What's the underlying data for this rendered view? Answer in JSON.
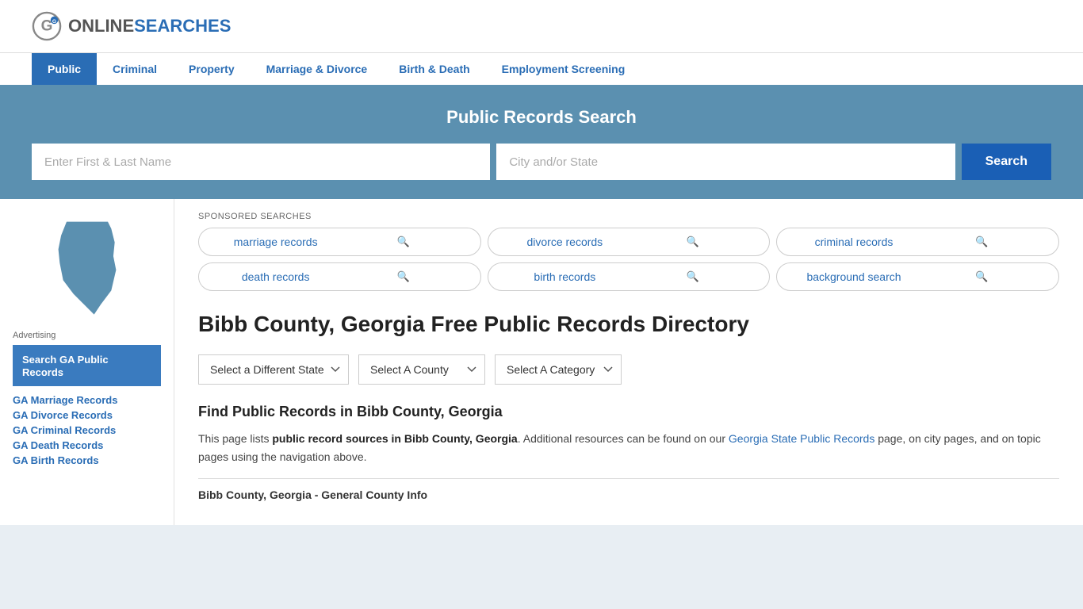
{
  "site": {
    "logo_text_online": "ONLINE",
    "logo_text_searches": "SEARCHES"
  },
  "nav": {
    "items": [
      {
        "label": "Public",
        "active": true
      },
      {
        "label": "Criminal",
        "active": false
      },
      {
        "label": "Property",
        "active": false
      },
      {
        "label": "Marriage & Divorce",
        "active": false
      },
      {
        "label": "Birth & Death",
        "active": false
      },
      {
        "label": "Employment Screening",
        "active": false
      }
    ]
  },
  "search_banner": {
    "title": "Public Records Search",
    "name_placeholder": "Enter First & Last Name",
    "location_placeholder": "City and/or State",
    "button_label": "Search"
  },
  "sponsored": {
    "label": "SPONSORED SEARCHES",
    "items": [
      "marriage records",
      "divorce records",
      "criminal records",
      "death records",
      "birth records",
      "background search"
    ]
  },
  "page": {
    "title": "Bibb County, Georgia Free Public Records Directory",
    "dropdowns": {
      "state": "Select a Different State",
      "county": "Select A County",
      "category": "Select A Category"
    },
    "find_heading": "Find Public Records in Bibb County, Georgia",
    "body_text_1": "This page lists ",
    "body_text_bold": "public record sources in Bibb County, Georgia",
    "body_text_2": ". Additional resources can be found on our ",
    "body_link_text": "Georgia State Public Records",
    "body_text_3": " page, on city pages, and on topic pages using the navigation above.",
    "county_info_heading": "Bibb County, Georgia - General County Info"
  },
  "sidebar": {
    "ad_label": "Advertising",
    "ad_block_text": "Search GA Public Records",
    "links": [
      "GA Marriage Records",
      "GA Divorce Records",
      "GA Criminal Records",
      "GA Death Records",
      "GA Birth Records"
    ]
  }
}
